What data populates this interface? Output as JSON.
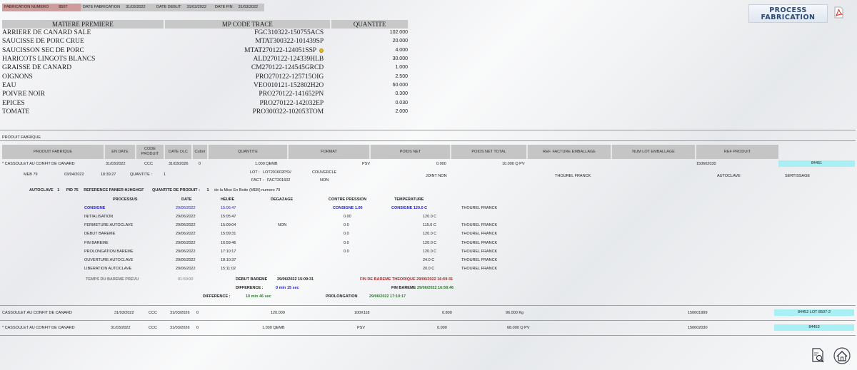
{
  "topbar": {
    "fab_label": "FABRICATION NUMERO",
    "fab_value": "8507",
    "date_fab_label": "DATE FABRICATION",
    "date_fab_value": "31/03/2022",
    "date_debut_label": "DATE DEBUT",
    "date_debut_value": "31/03/2022",
    "date_fin_label": "DATE FIN",
    "date_fin_value": "31/03/2022"
  },
  "logo": {
    "line1": "PROCESS",
    "line2": "FABRICATION"
  },
  "mp_table": {
    "headers": [
      "MATIERE PREMIERE",
      "MP CODE TRACE",
      "QUANTITE"
    ],
    "rows": [
      {
        "name": "ARRIERE DE CANARD SALE",
        "code": "FGC310322-150755ACS",
        "qty": "102.000"
      },
      {
        "name": "SAUCISSE DE PORC CRUE",
        "code": "MTAT300322-101439SP",
        "qty": "20.000"
      },
      {
        "name": "SAUCISSON SEC DE PORC",
        "code": "MTAT270122-124051SSP",
        "qty": "4.000"
      },
      {
        "name": "HARICOTS LINGOTS BLANCS",
        "code": "ALD270122-124339HLB",
        "qty": "30.000"
      },
      {
        "name": "GRAISSE DE CANARD",
        "code": "CM270122-124545GRCD",
        "qty": "1.000"
      },
      {
        "name": "OIGNONS",
        "code": "PRO270122-125715OIG",
        "qty": "2.500"
      },
      {
        "name": "EAU",
        "code": "VEO010121-152802H2O",
        "qty": "60.000"
      },
      {
        "name": "POIVRE NOIR",
        "code": "PRO270122-141652PN",
        "qty": "0.300"
      },
      {
        "name": "EPICES",
        "code": "PRO270122-142032EP",
        "qty": "0.030"
      },
      {
        "name": "TOMATE",
        "code": "PRO300322-102053TOM",
        "qty": "2.000"
      }
    ]
  },
  "section_title": "PRODUIT FABRIQUE",
  "product_headers": {
    "produit": "PRODUIT FABRIQUE",
    "en_date": "EN DATE",
    "code1": "CODE",
    "code2": "PRODUIT",
    "date_dlc": "DATE DLC",
    "cutter": "Cutter",
    "quantite": "QUANTITE",
    "format": "FORMAT",
    "poids_net": "POIDS NET",
    "poids_net_total": "POIDS NET TOTAL",
    "ref_facture": "REF. FACTURE EMBALLAGE",
    "num_lot": "NUM LOT EMBALLAGE",
    "ref_produit": "REF PRODUIT"
  },
  "product1": {
    "name": "* CASSOULET AU CONFIT DE CANARD",
    "en_date": "31/03/2022",
    "code": "CCC",
    "dlc": "31/03/2026",
    "cutter": "0",
    "quantite": "1.000 QEMB",
    "format": "PSV",
    "poids_net": "0.000",
    "poids_total": "10.000 Q PV",
    "ref_produit": "150602030",
    "lot": "84451"
  },
  "meb": {
    "label": "MEB 79",
    "date": "03/04/2022",
    "time": "18:39:27",
    "qty_label": "QUANTITE :",
    "qty": "1",
    "lot_label": "LOT :",
    "lot": "LOT201602PSV",
    "fact_label": "FACT :",
    "fact": "FACT201602",
    "couvercle": "COUVERCLE",
    "couvercle_val": "NON",
    "joint": "JOINT NON",
    "operator": "THOUREL FRANCK",
    "autoclave": "AUTOCLAVE",
    "sertissage": "SERTISSAGE"
  },
  "autoclave_line": {
    "autoclave": "AUTOCLAVE",
    "autoclave_num": "1",
    "pid": "PID 75",
    "ref_label": "REFERENCE PANIER HJHGHGF",
    "qty_label": "QUANTITE DE PRODUIT :",
    "qty": "1",
    "tail": "de la Mise En Boite (MEB) numero 79"
  },
  "process_headers": [
    "PROCESSUS",
    "DATE",
    "HEURE",
    "DEGAZAGE",
    "CONTRE PRESSION",
    "TEMPERATURE"
  ],
  "consigne": {
    "label": "CONSIGNE",
    "date": "29/06/2022",
    "time": "15:06:47",
    "pression": "CONSIGNE 1.00",
    "temp": "CONSIGNE 120.0 C",
    "operator": "THOUREL FRANCK"
  },
  "process_rows": [
    {
      "label": "INITIALISATION",
      "date": "29/06/2022",
      "time": "15:05:47",
      "degazage": "",
      "pression": "0.00",
      "temp": "120.0 C",
      "operator": ""
    },
    {
      "label": "FERMETURE AUTOCLAVE",
      "date": "29/06/2022",
      "time": "15:09:04",
      "degazage": "NON",
      "pression": "0.0",
      "temp": "115.0 C",
      "operator": "THOUREL FRANCK"
    },
    {
      "label": "DEBUT BAREME",
      "date": "29/06/2022",
      "time": "15:09:31",
      "degazage": "",
      "pression": "0.0",
      "temp": "120.0 C",
      "operator": "THOUREL FRANCK"
    },
    {
      "label": "FIN BAREME",
      "date": "29/06/2022",
      "time": "16:59:46",
      "degazage": "",
      "pression": "0.0",
      "temp": "120.0 C",
      "operator": "THOUREL FRANCK"
    },
    {
      "label": "PROLONGATION BAREME",
      "date": "29/06/2022",
      "time": "17:10:17",
      "degazage": "",
      "pression": "0.0",
      "temp": "120.0 C",
      "operator": "THOUREL FRANCK"
    },
    {
      "label": "OUVERTURE AUTOCLAVE",
      "date": "29/06/2022",
      "time": "18:10:37",
      "degazage": "",
      "pression": "",
      "temp": "24.0 C",
      "operator": "THOUREL FRANCK"
    },
    {
      "label": "LIBERATION AUTOCLAVE",
      "date": "29/06/2022",
      "time": "15:11:02",
      "degazage": "",
      "pression": "",
      "temp": "20.0 C",
      "operator": "THOUREL FRANCK"
    }
  ],
  "bareme": {
    "temps_label": "TEMPS DU BAREME PREVU",
    "temps_value": "01:50:00",
    "debut_label": "DEBUT BAREME",
    "debut_value": "29/06/2022 15:09:31",
    "fin_theo": "FIN DE BAREME THEORIQUE 29/06/2022 16:59:31",
    "diff_label": "DIFFERENCE :",
    "diff_value": "0 min  15 sec",
    "fin_bareme_label": "FIN BAREME",
    "fin_bareme_value": "29/06/2022 16:59:46",
    "diff2_label": "DIFFERENCE :",
    "diff2_value": "10 min  46 sec",
    "prolong_label": "PROLONGATION",
    "prolong_value": "29/06/2022 17:10:17"
  },
  "product2": {
    "name": "CASSOULET AU CONFIT DE CANARD",
    "en_date": "31/03/2022",
    "code": "CCC",
    "dlc": "31/03/2026",
    "cutter": "0",
    "quantite": "120.000",
    "format": "100X118",
    "poids_net": "0.800",
    "poids_total": "96.000 Kg",
    "ref_produit": "150601999",
    "lot": "84452 LOT 8507-2"
  },
  "product3": {
    "name": "* CASSOULET AU CONFIT DE CANARD",
    "en_date": "31/03/2022",
    "code": "CCC",
    "dlc": "31/03/2026",
    "cutter": "0",
    "quantite": "1.000 QEMB",
    "format": "PSV",
    "poids_net": "0.000",
    "poids_total": "68.000 Q PV",
    "ref_produit": "150602030",
    "lot": "84453"
  }
}
